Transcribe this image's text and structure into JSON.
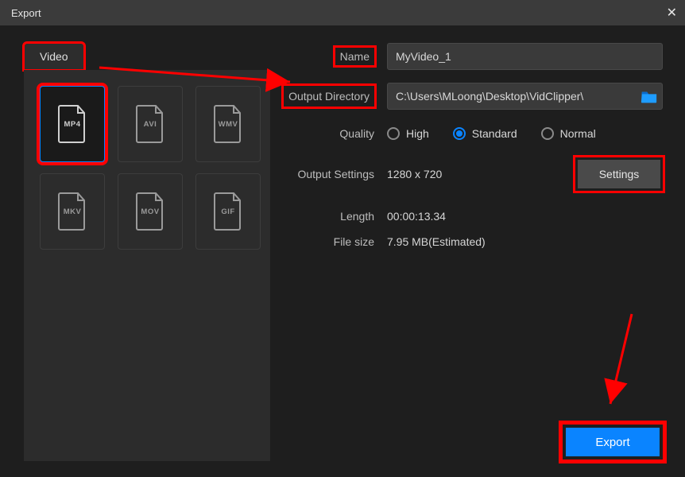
{
  "window": {
    "title": "Export"
  },
  "tabs": {
    "video": "Video"
  },
  "formats": [
    {
      "code": "MP4",
      "selected": true
    },
    {
      "code": "AVI",
      "selected": false
    },
    {
      "code": "WMV",
      "selected": false
    },
    {
      "code": "MKV",
      "selected": false
    },
    {
      "code": "MOV",
      "selected": false
    },
    {
      "code": "GIF",
      "selected": false
    }
  ],
  "fields": {
    "name_label": "Name",
    "name_value": "MyVideo_1",
    "dir_label": "Output Directory",
    "dir_value": "C:\\Users\\MLoong\\Desktop\\VidClipper\\",
    "quality_label": "Quality",
    "quality_options": {
      "high": "High",
      "standard": "Standard",
      "normal": "Normal"
    },
    "quality_selected": "standard",
    "output_settings_label": "Output Settings",
    "output_settings_value": "1280 x 720",
    "settings_btn": "Settings",
    "length_label": "Length",
    "length_value": "00:00:13.34",
    "filesize_label": "File size",
    "filesize_value": "7.95 MB(Estimated)"
  },
  "export_btn": "Export",
  "colors": {
    "accent": "#0a84ff",
    "highlight": "#ff0000"
  }
}
